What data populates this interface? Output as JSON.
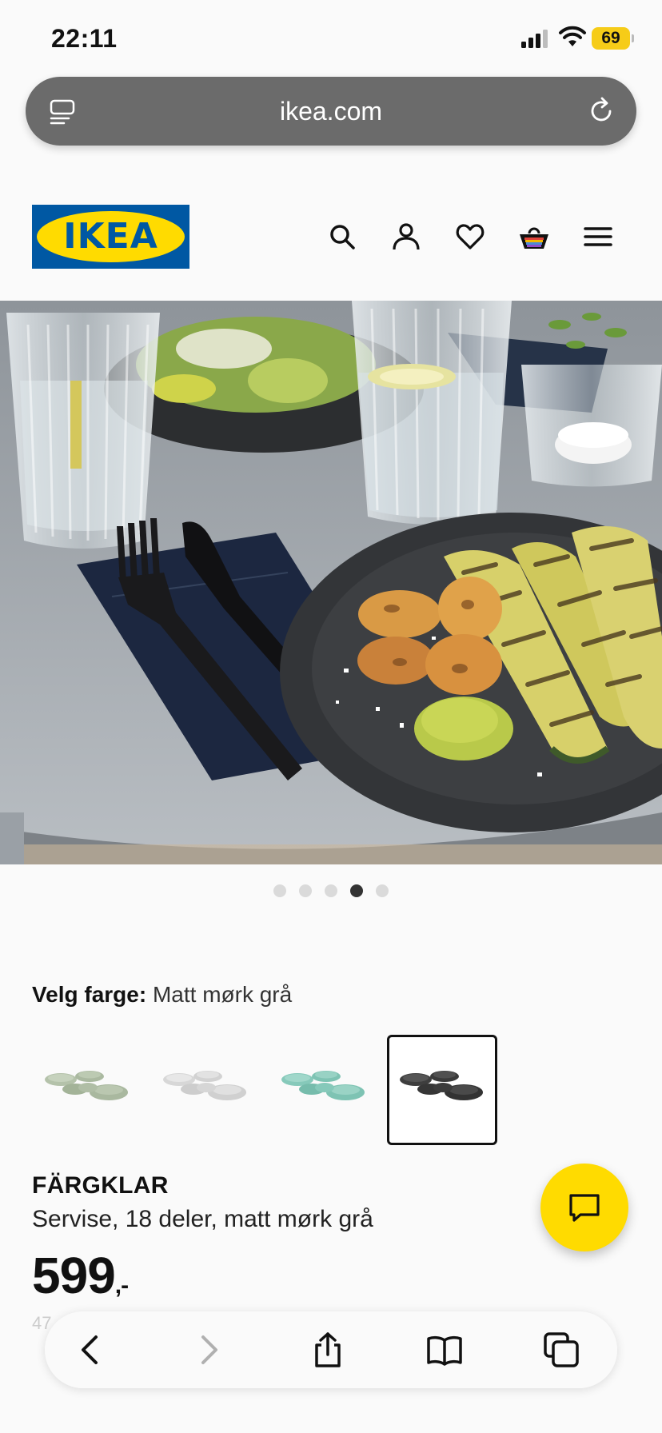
{
  "status_bar": {
    "time": "22:11",
    "battery": "69"
  },
  "browser": {
    "url": "ikea.com"
  },
  "header": {
    "logo_text": "IKEA",
    "logo_colors": {
      "blue": "#0058a3",
      "yellow": "#ffdb00"
    },
    "icons": [
      "search-icon",
      "account-icon",
      "heart-icon",
      "cart-icon",
      "menu-icon"
    ]
  },
  "gallery": {
    "image_count": 5,
    "active_index": 3
  },
  "color_selector": {
    "label": "Velg farge:",
    "selected_value": "Matt mørk grå",
    "swatches": [
      {
        "name": "green",
        "color": "#a9b8a0"
      },
      {
        "name": "light-grey",
        "color": "#dcdcdc"
      },
      {
        "name": "turquoise",
        "color": "#88cbbd"
      },
      {
        "name": "dark-grey",
        "color": "#4a4a4a"
      }
    ],
    "selected_index": 3
  },
  "product": {
    "name": "FÄRGKLAR",
    "description": "Servise, 18 deler, matt mørk grå",
    "price": "599",
    "price_suffix": ",-",
    "faded_text": "47"
  },
  "chat": {
    "icon": "chat-icon",
    "color": "#ffdb00"
  },
  "toolbar": {
    "icons": [
      "back-icon",
      "forward-icon",
      "share-icon",
      "bookmarks-icon",
      "tabs-icon"
    ]
  }
}
